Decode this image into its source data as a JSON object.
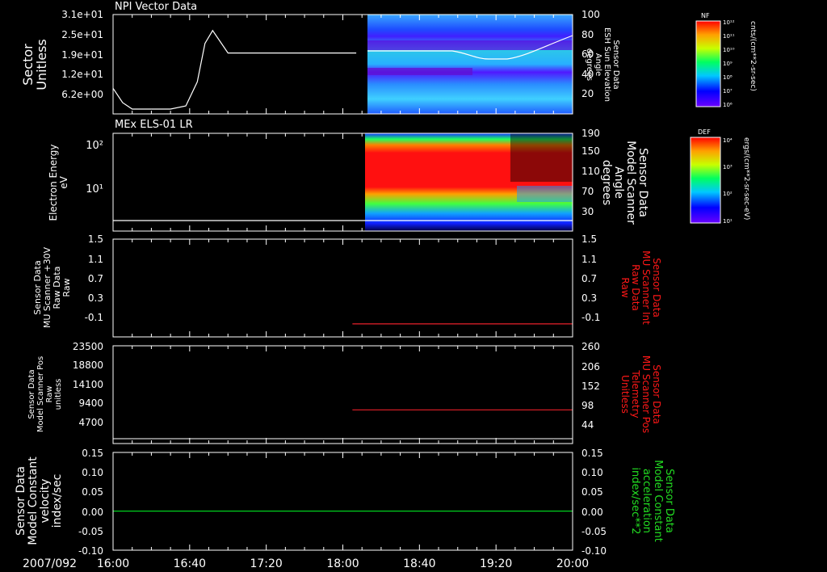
{
  "date_label": "2007/092",
  "time_axis": {
    "ticks": [
      "16:00",
      "16:40",
      "17:20",
      "18:00",
      "18:40",
      "19:20",
      "20:00"
    ]
  },
  "panels": [
    {
      "id": "npi",
      "title": "NPI Vector Data",
      "ylabel_left": [
        "Sector",
        "Unitless"
      ],
      "ylabel_right": [
        "Sensor Data",
        "ESH Sun Elevation",
        "Angle",
        "degrees"
      ],
      "left_ticks": [
        "3.1e+01",
        "2.5e+01",
        "1.9e+01",
        "1.2e+01",
        "6.2e+00"
      ],
      "right_ticks": [
        "100",
        "80",
        "60",
        "40",
        "20"
      ],
      "colorbar": {
        "label": "NF",
        "units": "cnts/(cm**2-sr-sec)",
        "ticks": [
          "10¹²",
          "10¹¹",
          "10¹⁰",
          "10⁹",
          "10⁸",
          "10⁷",
          "10⁶"
        ]
      }
    },
    {
      "id": "els",
      "title": "MEx ELS-01 LR",
      "ylabel_left": [
        "Electron Energy",
        "eV"
      ],
      "ylabel_right": [
        "Sensor Data",
        "Model Scanner",
        "Angle",
        "degrees"
      ],
      "left_ticks": [
        "10²",
        "10¹"
      ],
      "right_ticks": [
        "190",
        "150",
        "110",
        "70",
        "30"
      ],
      "colorbar": {
        "label": "DEF",
        "units": "ergs/(cm**2-sr-sec-eV)",
        "ticks": [
          "10⁴",
          "10³",
          "10²",
          "10¹"
        ]
      }
    },
    {
      "id": "mu_int",
      "ylabel_left": [
        "Sensor Data",
        "MU Scanner +30V",
        "Raw Data",
        "Raw"
      ],
      "ylabel_right": [
        "Sensor Data",
        "MU Scanner Int",
        "Raw Data",
        "Raw"
      ],
      "left_ticks": [
        "1.5",
        "1.1",
        "0.7",
        "0.3",
        "-0.1"
      ],
      "right_ticks": [
        "1.5",
        "1.1",
        "0.7",
        "0.3",
        "-0.1"
      ]
    },
    {
      "id": "scanner_pos",
      "ylabel_left": [
        "Sensor Data",
        "Model Scanner Pos",
        "Raw",
        "unitless"
      ],
      "ylabel_right": [
        "Sensor Data",
        "MU Scanner Pos",
        "Telemetry",
        "Unitless"
      ],
      "left_ticks": [
        "23500",
        "18800",
        "14100",
        "9400",
        "4700"
      ],
      "right_ticks": [
        "260",
        "206",
        "152",
        "98",
        "44"
      ]
    },
    {
      "id": "constant",
      "ylabel_left": [
        "Sensor Data",
        "Model Constant",
        "velocity",
        "index/sec"
      ],
      "ylabel_right": [
        "Sensor Data",
        "Model Constant",
        "acceleration",
        "index/sec**2"
      ],
      "left_ticks": [
        "0.15",
        "0.10",
        "0.05",
        "0.00",
        "-0.05",
        "-0.10"
      ],
      "right_ticks": [
        "0.15",
        "0.10",
        "0.05",
        "0.00",
        "-0.05",
        "-0.10"
      ]
    }
  ],
  "colors": {
    "red_trace": "#e8202a",
    "green_trace": "#00d21e",
    "right_label_red": "#ff1818",
    "right_label_green": "#22dd22"
  },
  "chart_data": [
    {
      "type": "line",
      "panel": "NPI Vector Data",
      "xlabel": "",
      "x": [
        "16:00",
        "16:05",
        "16:10",
        "16:20",
        "16:30",
        "16:38",
        "16:44",
        "16:48",
        "16:52",
        "17:00",
        "17:40",
        "18:07"
      ],
      "y": [
        8.0,
        3.5,
        1.5,
        1.5,
        1.5,
        2.5,
        10.0,
        22.0,
        26.0,
        19.0,
        19.0,
        19.0
      ],
      "ylim": [
        0,
        31
      ],
      "spectrogram": {
        "x_range": [
          "18:07",
          "20:00"
        ],
        "color_scale": "log",
        "clim": [
          "10⁶",
          "10¹²"
        ]
      }
    },
    {
      "type": "heatmap",
      "panel": "MEx ELS-01 LR",
      "xlabel": "",
      "ylabel": "Electron Energy eV",
      "x_range": [
        "18:05",
        "20:00"
      ],
      "yscale": "log",
      "color_scale": "log",
      "clim": [
        "10¹",
        "10⁴"
      ],
      "line": {
        "x": [
          "16:00",
          "20:00"
        ],
        "y_right": [
          20,
          20
        ],
        "y_right_range": [
          0,
          190
        ]
      }
    },
    {
      "type": "line",
      "panel": "MU Scanner Int Raw Data",
      "series": [
        {
          "x": [
            "18:05",
            "20:00"
          ],
          "y": [
            -0.06,
            -0.06
          ]
        }
      ],
      "ylim": [
        -0.3,
        1.5
      ]
    },
    {
      "type": "line",
      "panel": "MU Scanner Pos Telemetry",
      "series": [
        {
          "x": [
            "18:05",
            "20:00"
          ],
          "y": [
            8100,
            8100
          ]
        }
      ],
      "ylim": [
        0,
        23500
      ]
    },
    {
      "type": "line",
      "panel": "Model Constant velocity",
      "series": [
        {
          "x": [
            "16:00",
            "20:00"
          ],
          "y": [
            0,
            0
          ]
        }
      ],
      "ylim": [
        -0.1,
        0.15
      ]
    }
  ]
}
